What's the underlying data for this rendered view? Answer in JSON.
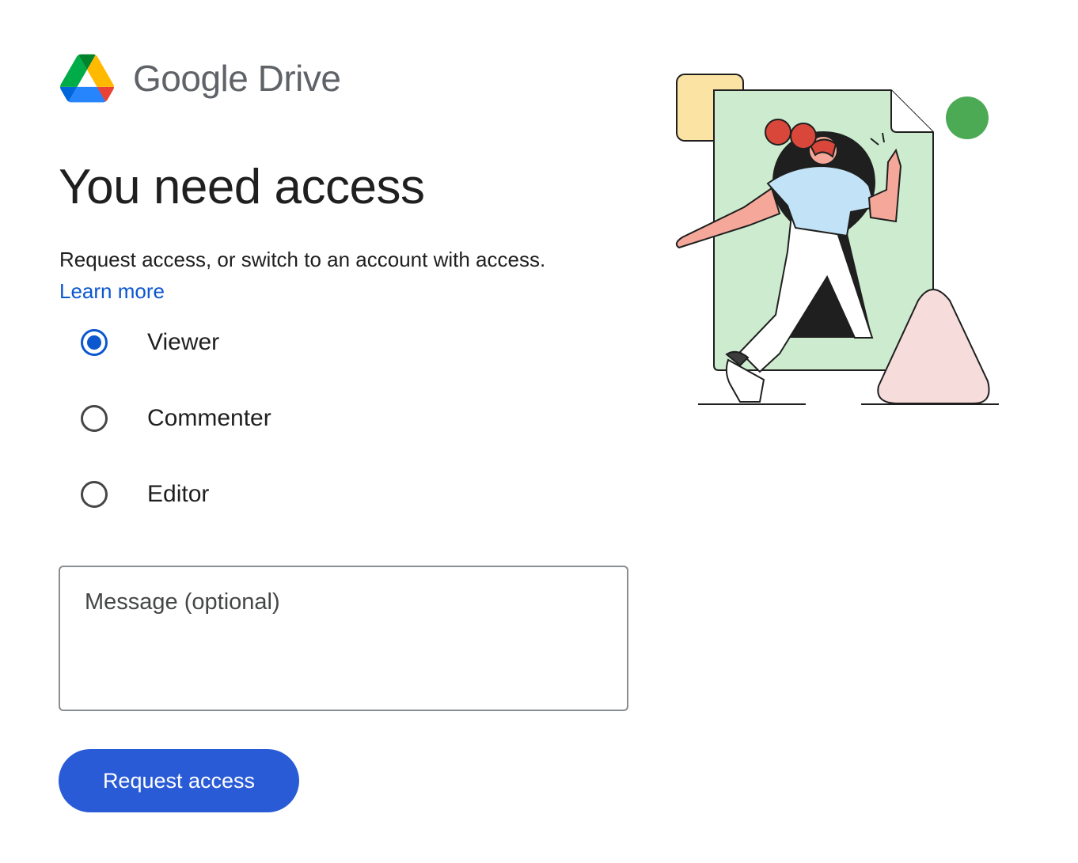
{
  "app": {
    "logo_text": "Google Drive",
    "logo_icon": "google-drive-icon"
  },
  "page": {
    "title": "You need access",
    "description": "Request access, or switch to an account with access.",
    "learn_more": "Learn more"
  },
  "roles": {
    "selected": "Viewer",
    "options": [
      {
        "label": "Viewer",
        "checked": true
      },
      {
        "label": "Commenter",
        "checked": false
      },
      {
        "label": "Editor",
        "checked": false
      }
    ]
  },
  "message": {
    "placeholder": "Message (optional)",
    "value": ""
  },
  "actions": {
    "request_label": "Request access"
  },
  "colors": {
    "accent": "#0b57d0",
    "button": "#2a5bd7",
    "logo_green": "#34a853",
    "logo_yellow": "#fbbc04",
    "logo_blue": "#4285f4",
    "logo_red": "#ea4335"
  }
}
